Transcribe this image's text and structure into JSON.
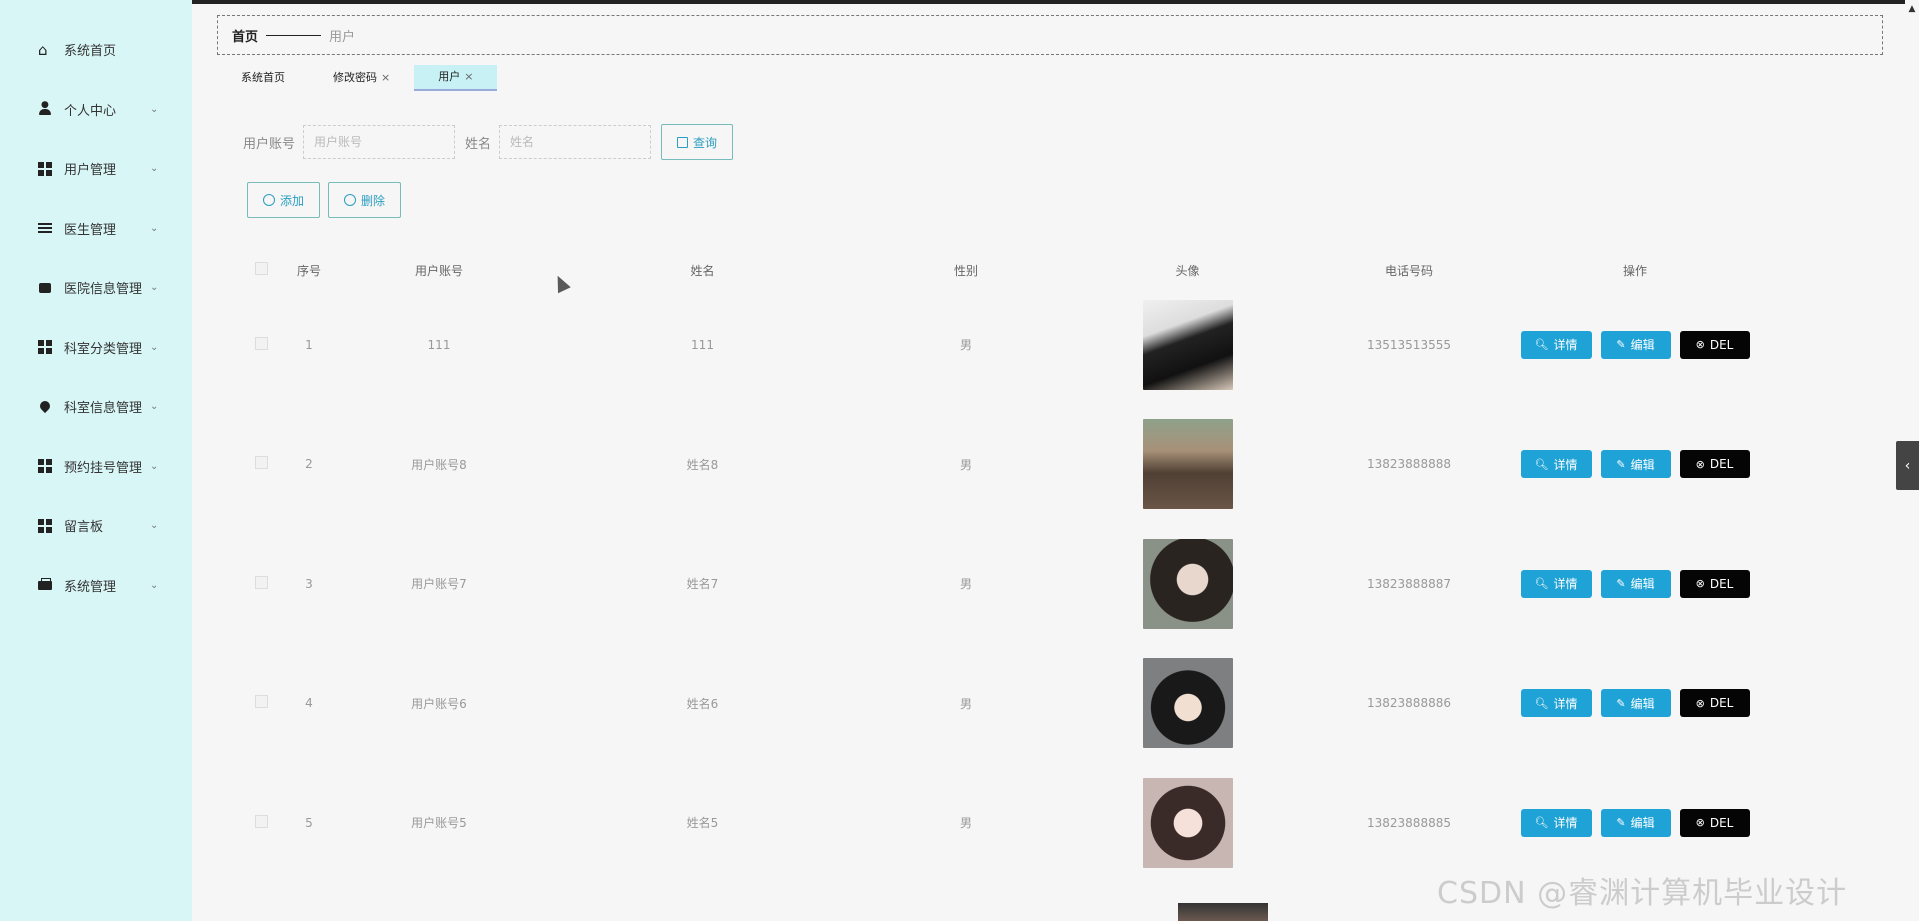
{
  "sidebar": {
    "items": [
      {
        "label": "系统首页",
        "icon": "home-icon",
        "has_submenu": false
      },
      {
        "label": "个人中心",
        "icon": "user-icon",
        "has_submenu": true
      },
      {
        "label": "用户管理",
        "icon": "grid-icon",
        "has_submenu": true
      },
      {
        "label": "医生管理",
        "icon": "sliders-icon",
        "has_submenu": true
      },
      {
        "label": "医院信息管理",
        "icon": "box-icon",
        "has_submenu": true
      },
      {
        "label": "科室分类管理",
        "icon": "grid-icon",
        "has_submenu": true
      },
      {
        "label": "科室信息管理",
        "icon": "pin-icon",
        "has_submenu": true
      },
      {
        "label": "预约挂号管理",
        "icon": "grid-icon",
        "has_submenu": true
      },
      {
        "label": "留言板",
        "icon": "grid-icon",
        "has_submenu": true
      },
      {
        "label": "系统管理",
        "icon": "wallet-icon",
        "has_submenu": true
      }
    ]
  },
  "breadcrumb": {
    "home": "首页",
    "current": "用户"
  },
  "tabs": [
    {
      "label": "系统首页",
      "closable": false,
      "active": false
    },
    {
      "label": "修改密码",
      "closable": true,
      "active": false
    },
    {
      "label": "用户",
      "closable": true,
      "active": true
    }
  ],
  "tab_close_glyph": "×",
  "search": {
    "account_label": "用户账号",
    "account_placeholder": "用户账号",
    "name_label": "姓名",
    "name_placeholder": "姓名",
    "search_button": "查询"
  },
  "actions": {
    "add": "添加",
    "delete": "删除"
  },
  "table": {
    "headers": {
      "index": "序号",
      "account": "用户账号",
      "name": "姓名",
      "sex": "性别",
      "avatar": "头像",
      "phone": "电话号码",
      "ops": "操作"
    },
    "rows": [
      {
        "index": "1",
        "account": "111",
        "name": "111",
        "sex": "男",
        "phone": "13513513555"
      },
      {
        "index": "2",
        "account": "用户账号8",
        "name": "姓名8",
        "sex": "男",
        "phone": "13823888888"
      },
      {
        "index": "3",
        "account": "用户账号7",
        "name": "姓名7",
        "sex": "男",
        "phone": "13823888887"
      },
      {
        "index": "4",
        "account": "用户账号6",
        "name": "姓名6",
        "sex": "男",
        "phone": "13823888886"
      },
      {
        "index": "5",
        "account": "用户账号5",
        "name": "姓名5",
        "sex": "男",
        "phone": "13823888885"
      }
    ],
    "row_buttons": {
      "detail": "详情",
      "edit": "编辑",
      "del": "DEL"
    }
  },
  "watermark": "CSDN @睿渊计算机毕业设计",
  "colors": {
    "sidebar_bg": "#d9f6f7",
    "primary": "#1fa2d6",
    "danger": "#050505",
    "active_tab": "#c7f1f4"
  }
}
